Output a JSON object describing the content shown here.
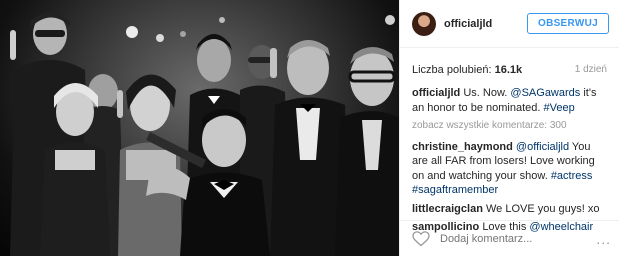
{
  "post": {
    "username": "officialjld",
    "follow_label": "OBSERWUJ",
    "likes_label": "Liczba polubień:",
    "likes_count": "16.1k",
    "time_ago": "1 dzień",
    "caption": {
      "user": "officialjld",
      "parts": [
        "Us. Now. ",
        "@SAGawards",
        " it's an honor to be nominated. ",
        "#Veep"
      ]
    },
    "view_all_comments": "zobacz wszystkie komentarze: 300",
    "comments": [
      {
        "user": "christine_haymond",
        "parts": [
          "@officialjld",
          " You are all FAR from losers! Love working on and watching your show. ",
          "#actress",
          " ",
          "#sagaftramember"
        ]
      },
      {
        "user": "littlecraigclan",
        "parts": [
          "We LOVE you guys! xo"
        ]
      },
      {
        "user": "sampollicino",
        "parts": [
          "Love this ",
          "@wheelchair"
        ]
      }
    ],
    "add_comment_placeholder": "Dodaj komentarz...",
    "more_icon_text": "..."
  },
  "colors": {
    "accent": "#3897f0",
    "link": "#003569",
    "muted": "#999999"
  }
}
